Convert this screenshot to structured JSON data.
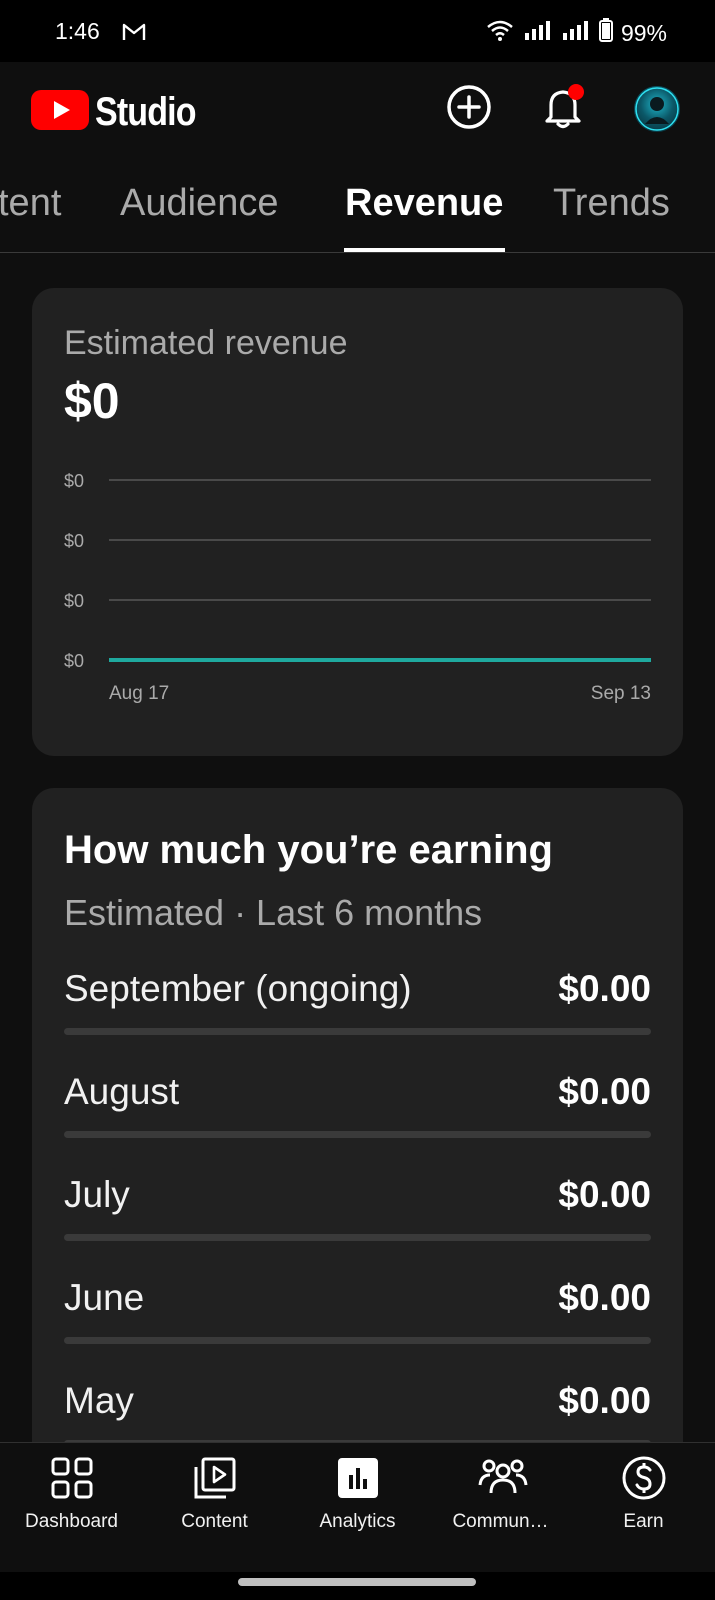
{
  "status_bar": {
    "time": "1:46",
    "battery": "99%"
  },
  "header": {
    "app_name": "Studio",
    "brand_color": "#ff0000",
    "notification_dot_color": "#ff0000"
  },
  "tabs": [
    {
      "label": "tent",
      "active": false
    },
    {
      "label": "Audience",
      "active": false
    },
    {
      "label": "Revenue",
      "active": true
    },
    {
      "label": "Trends",
      "active": false
    }
  ],
  "revenue_card": {
    "title": "Estimated revenue",
    "value": "$0"
  },
  "chart_data": {
    "type": "line",
    "title": "",
    "x": [
      "Aug 17",
      "Sep 13"
    ],
    "x_tick_labels": [
      "Aug 17",
      "Sep 13"
    ],
    "y_tick_labels": [
      "$0",
      "$0",
      "$0",
      "$0"
    ],
    "series": [
      {
        "values": [
          0,
          0
        ],
        "color": "#1fa99f"
      }
    ],
    "ylim": [
      0,
      0
    ],
    "grid": true
  },
  "earnings_card": {
    "title": "How much you’re earning",
    "subtitle": "Estimated · Last 6 months",
    "months": [
      {
        "name": "September (ongoing)",
        "value": "$0.00",
        "fraction": 0
      },
      {
        "name": "August",
        "value": "$0.00",
        "fraction": 0
      },
      {
        "name": "July",
        "value": "$0.00",
        "fraction": 0
      },
      {
        "name": "June",
        "value": "$0.00",
        "fraction": 0
      },
      {
        "name": "May",
        "value": "$0.00",
        "fraction": 0
      }
    ]
  },
  "bottom_nav": [
    {
      "label": "Dashboard",
      "icon": "dashboard-icon"
    },
    {
      "label": "Content",
      "icon": "content-icon"
    },
    {
      "label": "Analytics",
      "icon": "analytics-icon",
      "active": true
    },
    {
      "label": "Commun…",
      "icon": "community-icon"
    },
    {
      "label": "Earn",
      "icon": "earn-icon"
    }
  ]
}
